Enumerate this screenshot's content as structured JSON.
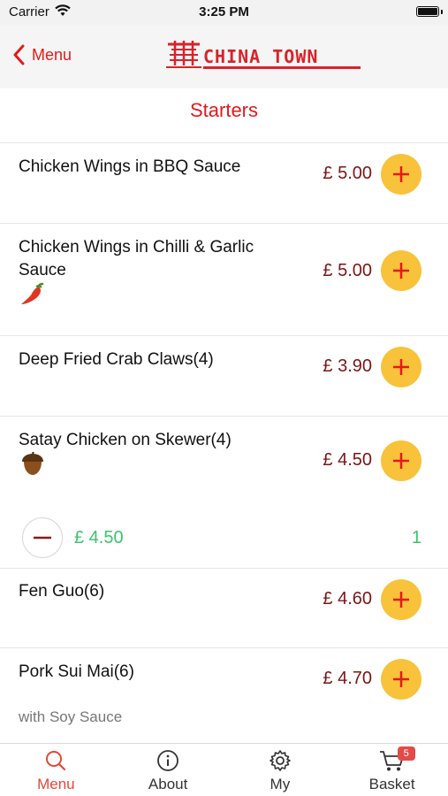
{
  "status_bar": {
    "carrier": "Carrier",
    "time": "3:25 PM"
  },
  "navbar": {
    "back_label": "Menu",
    "logo_text": "CHINA TOWN"
  },
  "section": {
    "title": "Starters"
  },
  "items": [
    {
      "name": "Chicken Wings in BBQ Sauce",
      "price": "£ 5.00",
      "icon": ""
    },
    {
      "name": "Chicken Wings in Chilli & Garlic Sauce",
      "price": "£ 5.00",
      "icon": "chili-icon"
    },
    {
      "name": "Deep Fried Crab Claws(4)",
      "price": "£ 3.90",
      "icon": ""
    },
    {
      "name": "Satay Chicken on Skewer(4)",
      "price": "£ 4.50",
      "icon": "nut-icon"
    },
    {
      "name": "Fen Guo(6)",
      "price": "£ 4.60",
      "icon": ""
    },
    {
      "name": "Pork Sui Mai(6)",
      "price": "£ 4.70",
      "icon": "",
      "description": "with Soy Sauce"
    }
  ],
  "quantity_row": {
    "price": "£ 4.50",
    "count": "1"
  },
  "tabbar": {
    "tabs": [
      {
        "label": "Menu",
        "icon": "search-icon",
        "active": true
      },
      {
        "label": "About",
        "icon": "info-icon",
        "active": false
      },
      {
        "label": "My",
        "icon": "gear-icon",
        "active": false
      },
      {
        "label": "Basket",
        "icon": "cart-icon",
        "active": false,
        "badge": "5"
      }
    ]
  },
  "colors": {
    "accent": "#e21a1a",
    "price": "#7a1515",
    "add_button": "#f8c23a",
    "qty": "#3cc46b"
  }
}
